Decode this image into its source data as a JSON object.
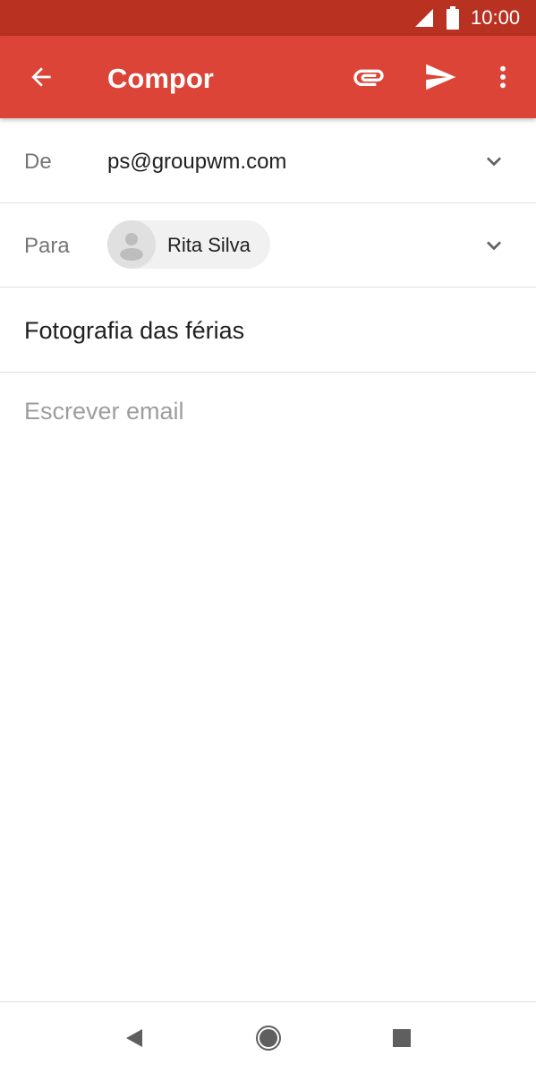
{
  "status_bar": {
    "time": "10:00",
    "icons": [
      "signal-icon",
      "battery-icon"
    ]
  },
  "app_bar": {
    "title": "Compor",
    "back_icon": "arrow-back-icon",
    "attach_icon": "paperclip-icon",
    "send_icon": "send-icon",
    "more_icon": "more-vert-icon",
    "background_color": "#db4437",
    "status_bar_color": "#b93221"
  },
  "compose": {
    "from": {
      "label": "De",
      "value": "ps@groupwm.com"
    },
    "to": {
      "label": "Para",
      "recipients": [
        {
          "name": "Rita Silva"
        }
      ]
    },
    "subject": "Fotografia das férias",
    "body_placeholder": "Escrever email"
  },
  "nav_bar": {
    "icons": [
      "nav-back-icon",
      "nav-home-icon",
      "nav-recents-icon"
    ]
  }
}
